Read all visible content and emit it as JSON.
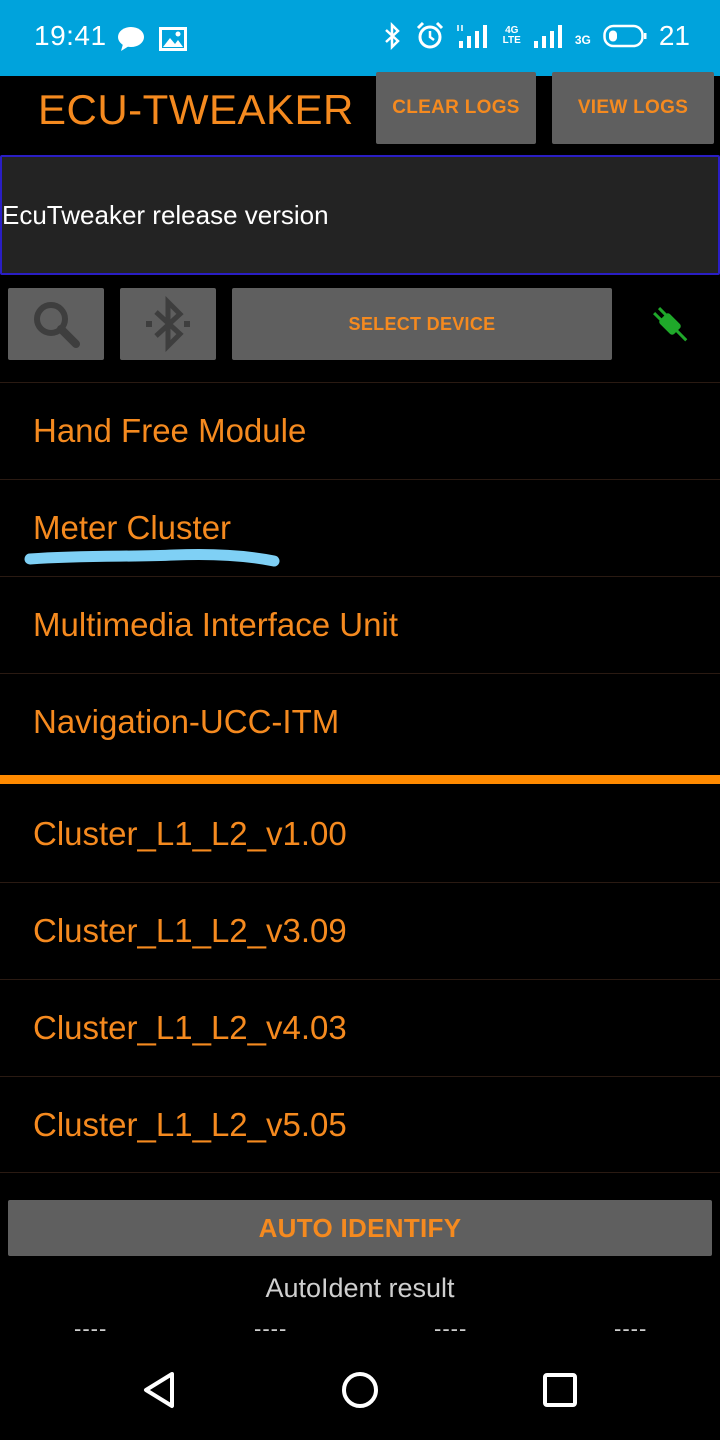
{
  "status_bar": {
    "time": "19:41",
    "battery": "21",
    "net_4g": "4G",
    "net_lte": "LTE",
    "net_3g": "3G",
    "icons": [
      "chat-icon",
      "image-icon",
      "bluetooth-icon",
      "alarm-icon",
      "signal-icon",
      "signal-icon",
      "battery-icon"
    ]
  },
  "header": {
    "title": "ECU-TWEAKER",
    "clear_logs": "CLEAR LOGS",
    "view_logs": "VIEW LOGS"
  },
  "log": {
    "text": "EcuTweaker release version"
  },
  "toolbar": {
    "select_device": "SELECT DEVICE",
    "icons": [
      "search-icon",
      "bluetooth-icon",
      "plug-icon"
    ],
    "plug_color": "#1fa82a"
  },
  "modules": [
    {
      "label": "Hand Free Module"
    },
    {
      "label": "Meter Cluster"
    },
    {
      "label": "Multimedia Interface Unit"
    },
    {
      "label": "Navigation-UCC-ITM"
    }
  ],
  "versions": [
    {
      "label": "Cluster_L1_L2_v1.00"
    },
    {
      "label": "Cluster_L1_L2_v3.09"
    },
    {
      "label": "Cluster_L1_L2_v4.03"
    },
    {
      "label": "Cluster_L1_L2_v5.05"
    }
  ],
  "auto_identify": {
    "button": "AUTO IDENTIFY",
    "result_label": "AutoIdent result",
    "values": [
      "----",
      "----",
      "----",
      "----"
    ]
  },
  "colors": {
    "accent": "#f58a1f",
    "status_bar": "#00a3dc",
    "button": "#5f5f5f",
    "divider": "#ff8a00",
    "highlight": "#7fd0f5"
  }
}
